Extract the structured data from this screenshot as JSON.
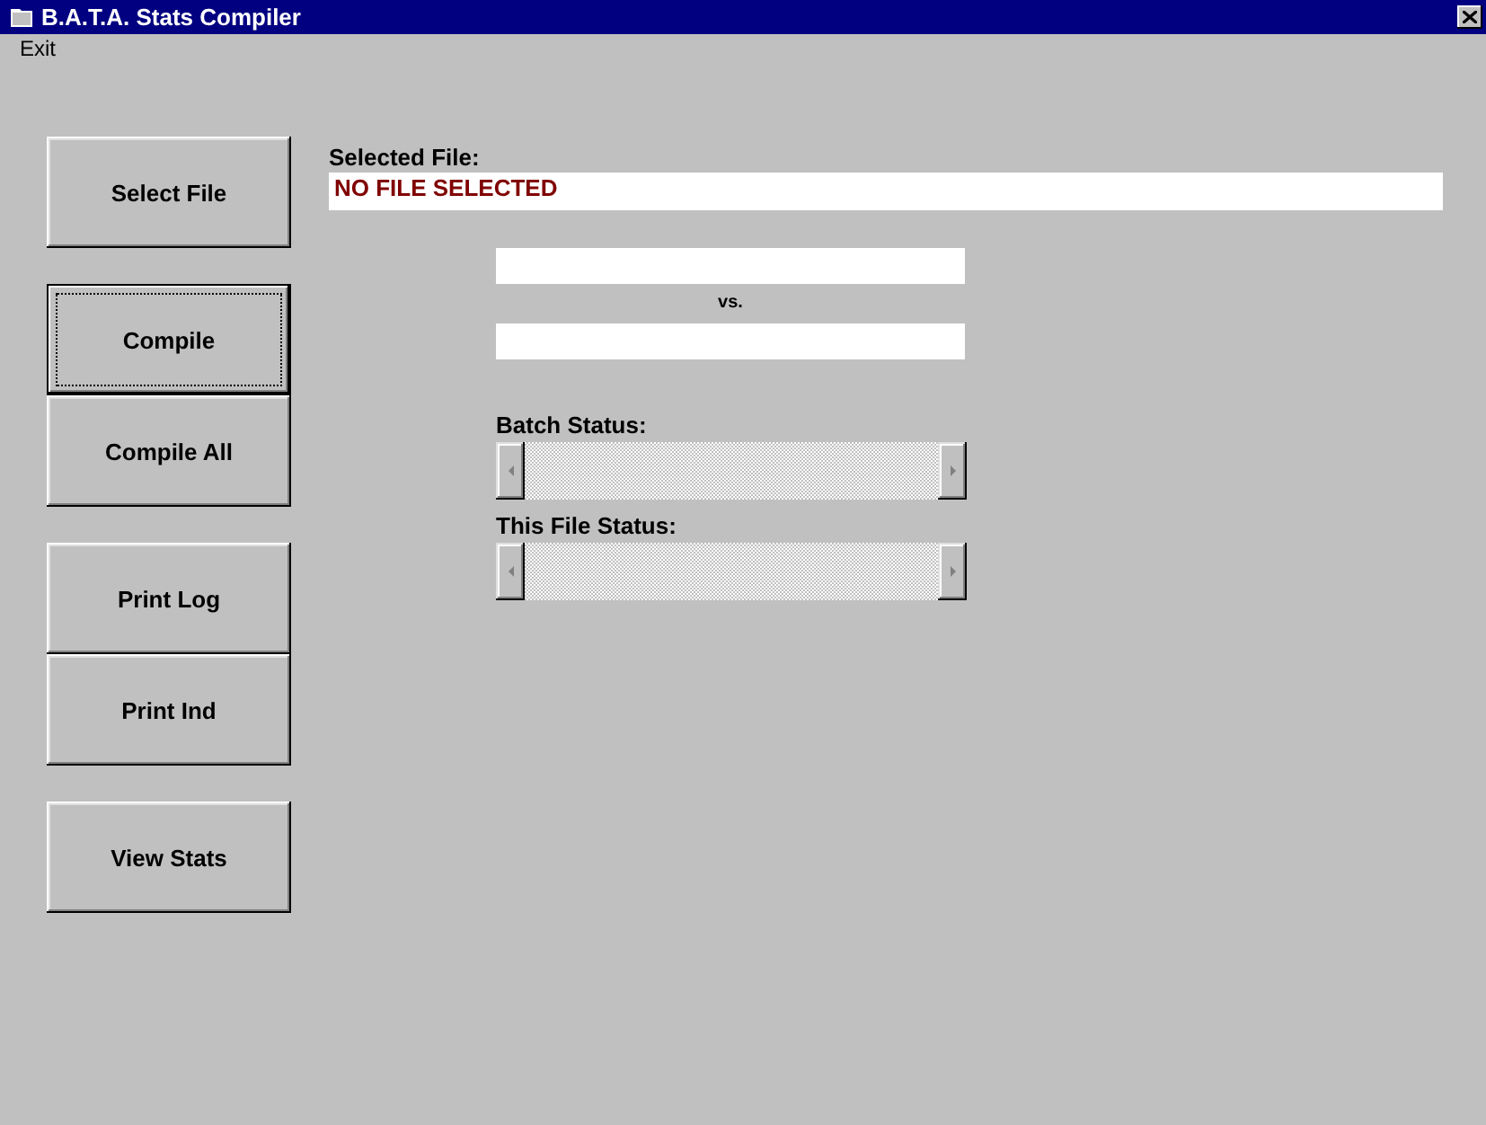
{
  "window": {
    "title": "B.A.T.A. Stats Compiler"
  },
  "menu": [
    {
      "label": "Exit"
    }
  ],
  "buttons": [
    {
      "label": "Select File",
      "focused": false
    },
    {
      "label": "Compile",
      "focused": true
    },
    {
      "label": "Compile All",
      "focused": false
    },
    {
      "label": "Print Log",
      "focused": false
    },
    {
      "label": "Print Ind",
      "focused": false
    },
    {
      "label": "View Stats",
      "focused": false
    }
  ],
  "selected_file": {
    "label": "Selected File:",
    "value": "NO FILE SELECTED"
  },
  "comparison": {
    "separator": "vs."
  },
  "status_bars": [
    {
      "label": "Batch Status:"
    },
    {
      "label": "This File Status:"
    }
  ]
}
